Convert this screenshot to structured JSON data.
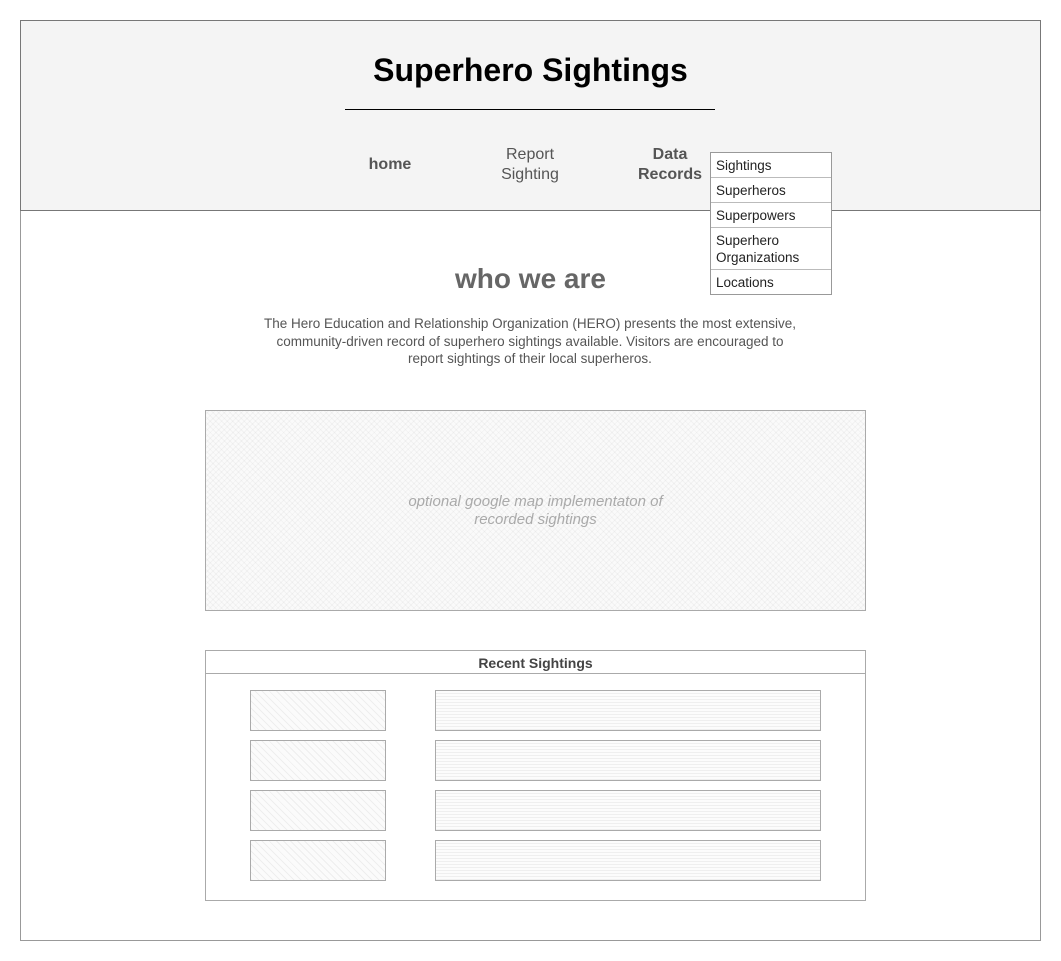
{
  "header": {
    "title": "Superhero Sightings"
  },
  "nav": {
    "home": "home",
    "report_line1": "Report",
    "report_line2": "Sighting",
    "data_line1": "Data",
    "data_line2": "Records"
  },
  "dropdown": {
    "items": [
      {
        "label_line1": "Sightings"
      },
      {
        "label_line1": "Superheros"
      },
      {
        "label_line1": "Superpowers"
      },
      {
        "label_line1": "Superhero",
        "label_line2": "Organizations"
      },
      {
        "label_line1": "Locations"
      }
    ]
  },
  "about": {
    "heading": "who we are",
    "line1": "The Hero Education and Relationship Organization (HERO) presents the most extensive,",
    "line2": "community-driven record of superhero sightings available. Visitors are encouraged to",
    "line3": "report sightings of their local superheros."
  },
  "map": {
    "placeholder_line1": "optional google map implementaton of",
    "placeholder_line2": "recorded sightings"
  },
  "recent": {
    "title": "Recent Sightings",
    "rows": 4
  }
}
